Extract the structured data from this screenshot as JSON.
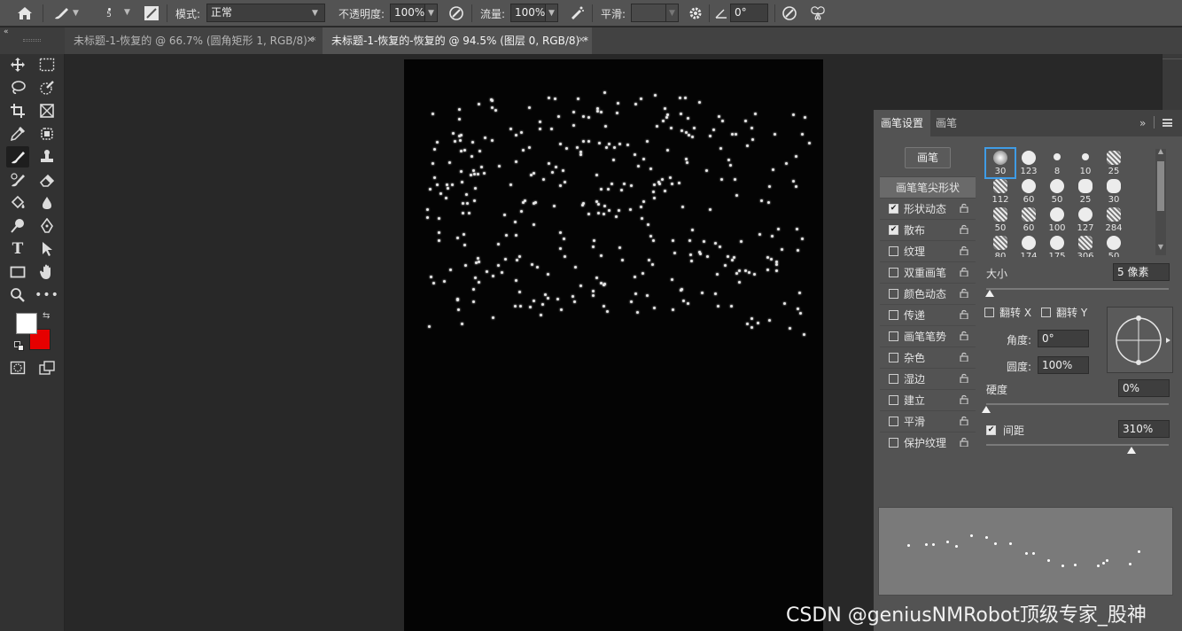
{
  "options_bar": {
    "brush_size_small": "5",
    "mode_label": "模式:",
    "mode_value": "正常",
    "opacity_label": "不透明度:",
    "opacity_value": "100%",
    "flow_label": "流量:",
    "flow_value": "100%",
    "smoothing_label": "平滑:",
    "smoothing_value": "",
    "angle_value": "0°"
  },
  "tabs": [
    {
      "label": "未标题-1-恢复的 @ 66.7% (圆角矩形 1, RGB/8) *",
      "active": false
    },
    {
      "label": "未标题-1-恢复的-恢复的 @ 94.5% (图层 0, RGB/8) *",
      "active": true
    }
  ],
  "toolbar": {
    "tools": [
      "move-icon",
      "marquee-icon",
      "lasso-icon",
      "quick-select-icon",
      "crop-icon",
      "frame-icon",
      "eyedropper-icon",
      "patch-icon",
      "brush-icon",
      "stamp-icon",
      "history-brush-icon",
      "eraser-icon",
      "bucket-icon",
      "drop-icon",
      "dodge-icon",
      "pen-icon",
      "type-icon",
      "path-select-icon",
      "rectangle-icon",
      "hand-icon",
      "zoom-icon",
      "more-icon"
    ],
    "foreground_color": "#ffffff",
    "background_color": "#e60000"
  },
  "brush_panel": {
    "tab_settings": "画笔设置",
    "tab_brushes": "画笔",
    "brushes_button": "画笔",
    "tip_shape": "画笔笔尖形状",
    "options": [
      {
        "label": "形状动态",
        "checked": true
      },
      {
        "label": "散布",
        "checked": true
      },
      {
        "label": "纹理",
        "checked": false
      },
      {
        "label": "双重画笔",
        "checked": false
      },
      {
        "label": "颜色动态",
        "checked": false
      },
      {
        "label": "传递",
        "checked": false
      },
      {
        "label": "画笔笔势",
        "checked": false
      },
      {
        "label": "杂色",
        "checked": false
      },
      {
        "label": "湿边",
        "checked": false
      },
      {
        "label": "建立",
        "checked": false
      },
      {
        "label": "平滑",
        "checked": false
      },
      {
        "label": "保护纹理",
        "checked": false
      }
    ],
    "presets": [
      "30",
      "123",
      "8",
      "10",
      "25",
      "112",
      "60",
      "50",
      "25",
      "30",
      "50",
      "60",
      "100",
      "127",
      "284",
      "80",
      "174",
      "175",
      "306",
      "50"
    ],
    "size_label": "大小",
    "size_value": "5 像素",
    "flip_x": "翻转 X",
    "flip_y": "翻转 Y",
    "angle_label": "角度:",
    "angle_value": "0°",
    "roundness_label": "圆度:",
    "roundness_value": "100%",
    "hardness_label": "硬度",
    "hardness_value": "0%",
    "spacing_label": "间距",
    "spacing_value": "310%"
  },
  "watermark": "CSDN @geniusNMRobot顶级专家_股神"
}
